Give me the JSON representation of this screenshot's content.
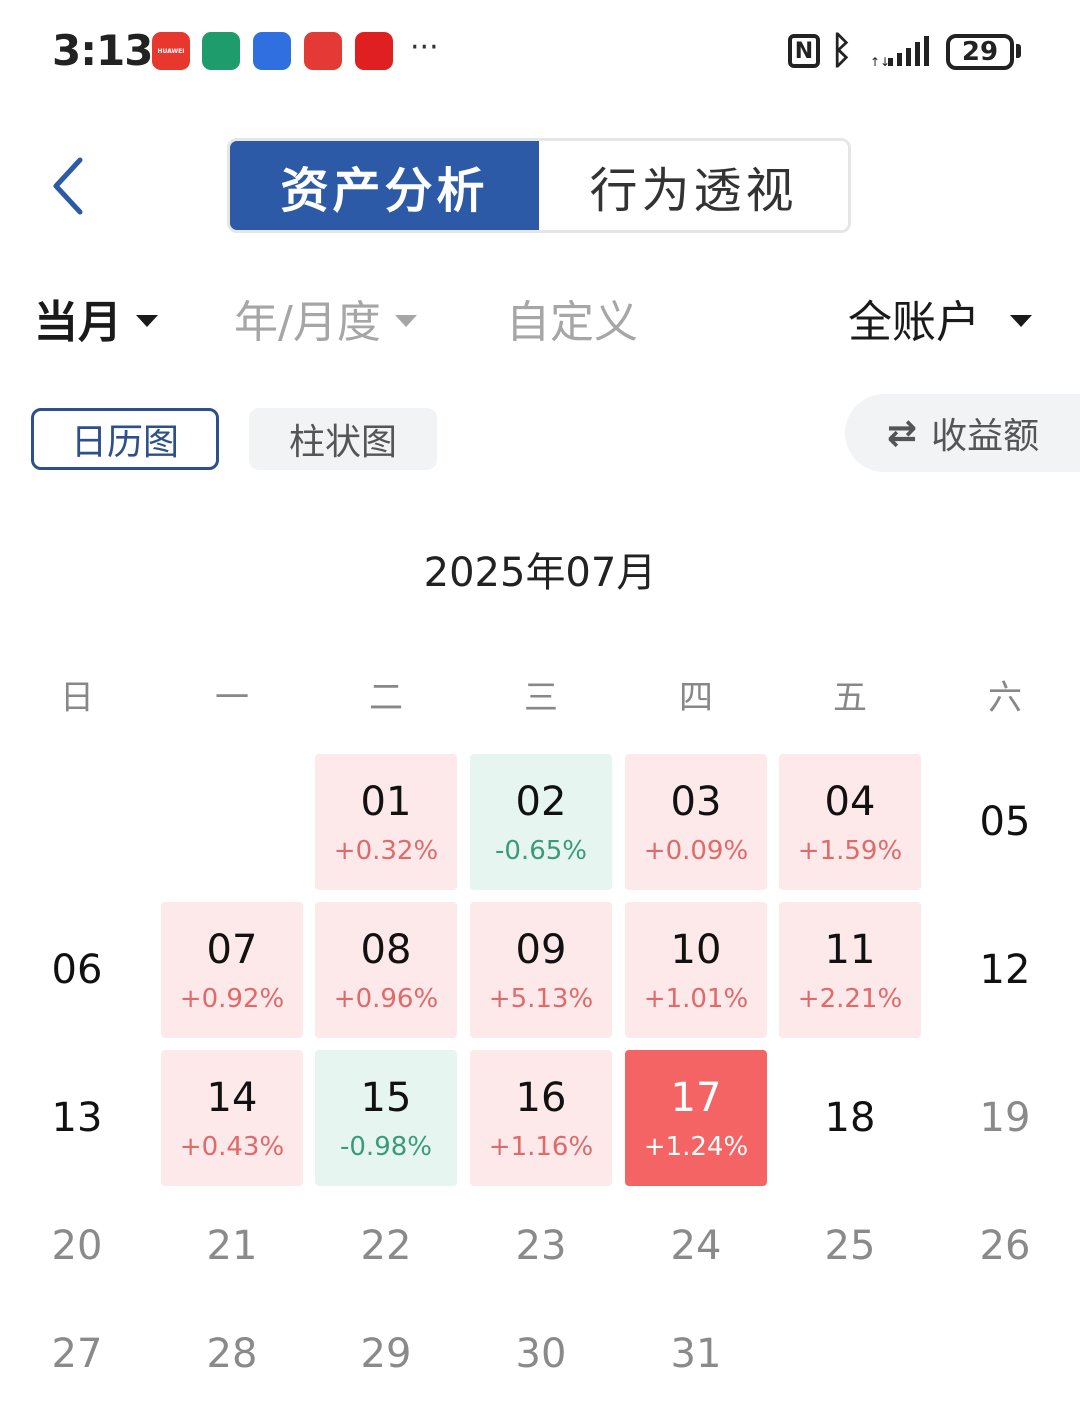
{
  "status_bar": {
    "time": "3:13",
    "battery": "29",
    "apps": [
      {
        "name": "huawei-app-icon",
        "color": "#e8382e",
        "label": "HUAWEI"
      },
      {
        "name": "bank-app-icon",
        "color": "#1f9c6b",
        "label": ""
      },
      {
        "name": "hand-app-icon",
        "color": "#2f6fe0",
        "label": ""
      },
      {
        "name": "book-app-icon",
        "color": "#e53935",
        "label": ""
      },
      {
        "name": "heart-app-icon",
        "color": "#e02020",
        "label": ""
      }
    ],
    "more": "···"
  },
  "header": {
    "tabs": [
      {
        "label": "资产分析",
        "active": true
      },
      {
        "label": "行为透视",
        "active": false
      }
    ]
  },
  "filters": {
    "month": "当月",
    "year_month": "年/月度",
    "custom": "自定义",
    "account": "全账户"
  },
  "view": {
    "calendar": "日历图",
    "bar": "柱状图",
    "metric": "收益额"
  },
  "calendar": {
    "title": "2025年07月",
    "weekdays": [
      "日",
      "一",
      "二",
      "三",
      "四",
      "五",
      "六"
    ],
    "colors": {
      "up_bg": "#fde9ea",
      "down_bg": "#e7f5f1",
      "today_bg": "#f46464"
    },
    "days": [
      {
        "day": "01",
        "pct": "+0.32%",
        "type": "up"
      },
      {
        "day": "02",
        "pct": "-0.65%",
        "type": "down"
      },
      {
        "day": "03",
        "pct": "+0.09%",
        "type": "up"
      },
      {
        "day": "04",
        "pct": "+1.59%",
        "type": "up"
      },
      {
        "day": "05",
        "pct": "",
        "type": "plain"
      },
      {
        "day": "06",
        "pct": "",
        "type": "plain"
      },
      {
        "day": "07",
        "pct": "+0.92%",
        "type": "up"
      },
      {
        "day": "08",
        "pct": "+0.96%",
        "type": "up"
      },
      {
        "day": "09",
        "pct": "+5.13%",
        "type": "up"
      },
      {
        "day": "10",
        "pct": "+1.01%",
        "type": "up"
      },
      {
        "day": "11",
        "pct": "+2.21%",
        "type": "up"
      },
      {
        "day": "12",
        "pct": "",
        "type": "plain"
      },
      {
        "day": "13",
        "pct": "",
        "type": "plain"
      },
      {
        "day": "14",
        "pct": "+0.43%",
        "type": "up"
      },
      {
        "day": "15",
        "pct": "-0.98%",
        "type": "down"
      },
      {
        "day": "16",
        "pct": "+1.16%",
        "type": "up"
      },
      {
        "day": "17",
        "pct": "+1.24%",
        "type": "today"
      },
      {
        "day": "18",
        "pct": "",
        "type": "plain"
      },
      {
        "day": "19",
        "pct": "",
        "type": "future"
      },
      {
        "day": "20",
        "pct": "",
        "type": "future"
      },
      {
        "day": "21",
        "pct": "",
        "type": "future"
      },
      {
        "day": "22",
        "pct": "",
        "type": "future"
      },
      {
        "day": "23",
        "pct": "",
        "type": "future"
      },
      {
        "day": "24",
        "pct": "",
        "type": "future"
      },
      {
        "day": "25",
        "pct": "",
        "type": "future"
      },
      {
        "day": "26",
        "pct": "",
        "type": "future"
      },
      {
        "day": "27",
        "pct": "",
        "type": "future"
      },
      {
        "day": "28",
        "pct": "",
        "type": "future"
      },
      {
        "day": "29",
        "pct": "",
        "type": "future"
      },
      {
        "day": "30",
        "pct": "",
        "type": "future"
      },
      {
        "day": "31",
        "pct": "",
        "type": "future"
      }
    ]
  }
}
